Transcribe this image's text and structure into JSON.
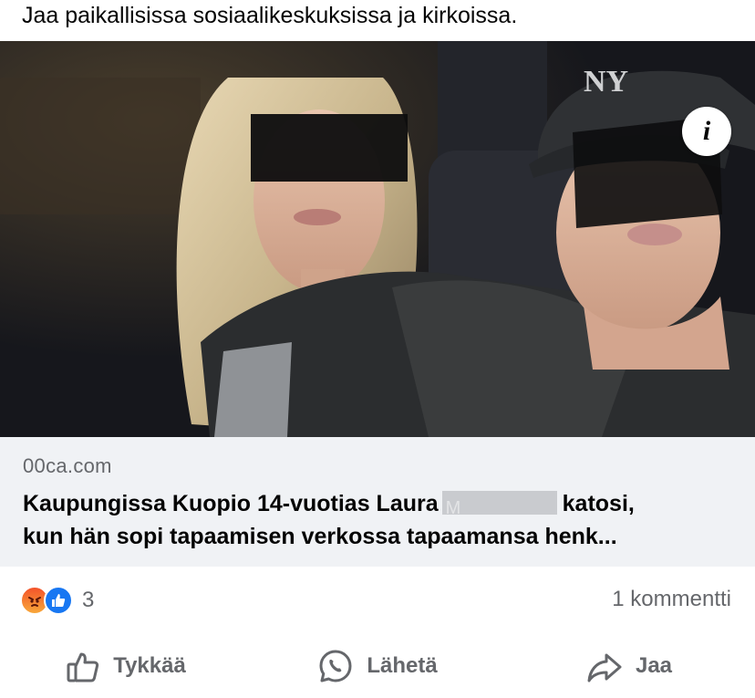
{
  "post": {
    "text": "Jaa paikallisissa sosiaalikeskuksissa ja kirkoissa."
  },
  "media": {
    "info_icon_glyph": "i",
    "watermark_cap_logo": "NY"
  },
  "link_preview": {
    "domain": "00ca.com",
    "headline_part1": "Kaupungissa Kuopio 14-vuotias Laura",
    "redacted_label": "M",
    "headline_part2": "katosi,",
    "headline_line2": "kun hän sopi tapaamisen verkossa tapaamansa henk..."
  },
  "engagement": {
    "reaction_icons": [
      "angry-icon",
      "like-icon"
    ],
    "reaction_count": "3",
    "comments_label": "1 kommentti"
  },
  "actions": {
    "like_label": "Tykkää",
    "send_label": "Lähetä",
    "share_label": "Jaa"
  },
  "colors": {
    "secondary_text": "#65676b",
    "link_bg": "#f0f2f5",
    "like_blue": "#1877f2"
  }
}
